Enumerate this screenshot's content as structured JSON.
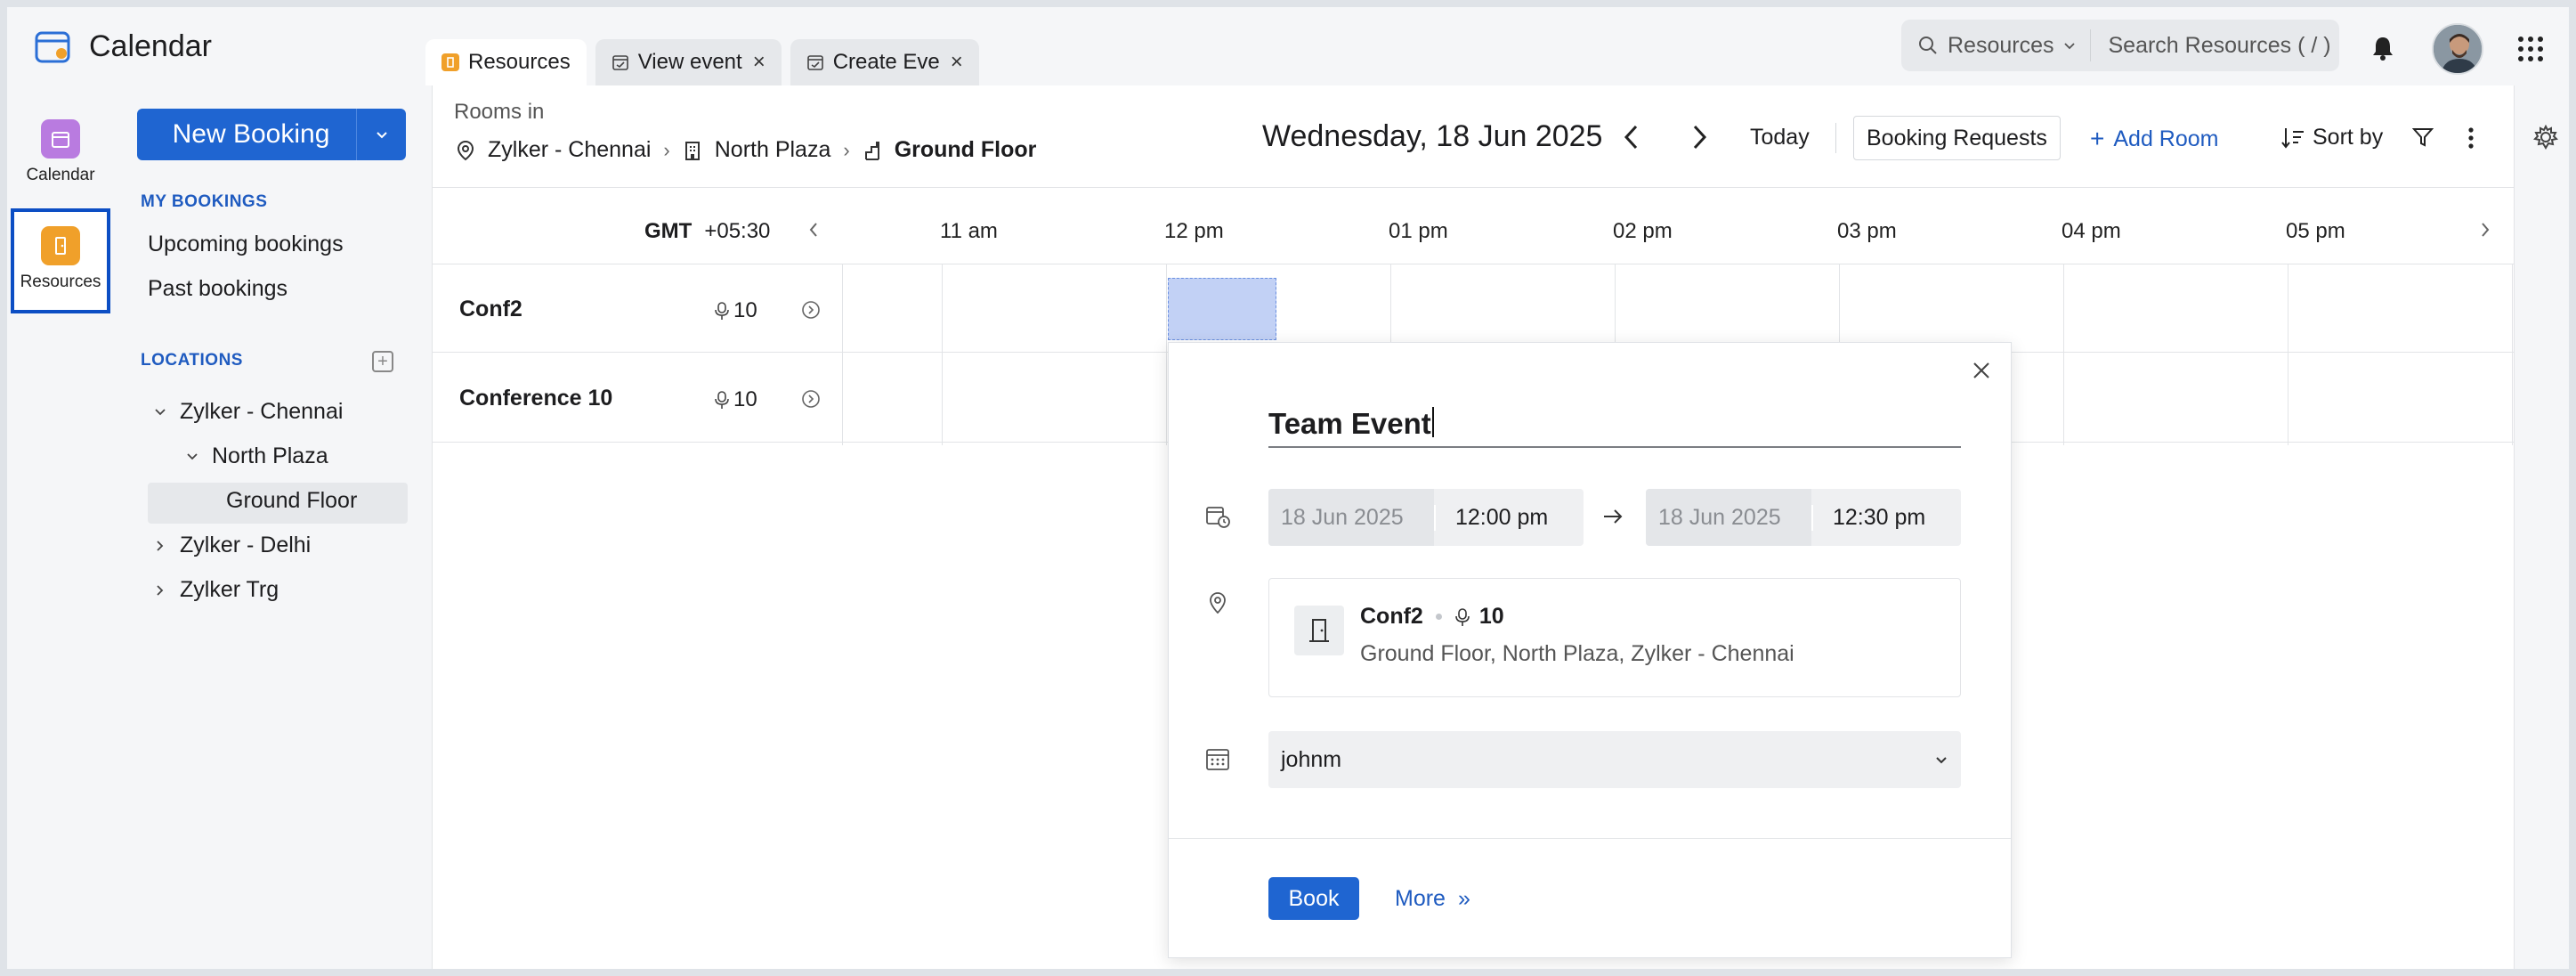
{
  "app": {
    "title": "Calendar"
  },
  "tabs": [
    {
      "label": "Resources"
    },
    {
      "label": "View event"
    },
    {
      "label": "Create Eve"
    }
  ],
  "search": {
    "scope": "Resources",
    "placeholder": "Search Resources ( / )"
  },
  "rail": {
    "calendar_label": "Calendar",
    "resources_label": "Resources"
  },
  "sidebar": {
    "new_booking": "New Booking",
    "my_bookings_heading": "MY BOOKINGS",
    "upcoming": "Upcoming bookings",
    "past": "Past bookings",
    "locations_heading": "LOCATIONS",
    "tree": [
      {
        "label": "Zylker - Chennai",
        "expanded": true
      },
      {
        "label": "North Plaza",
        "expanded": true
      },
      {
        "label": "Ground Floor",
        "selected": true
      },
      {
        "label": "Zylker - Delhi",
        "expanded": false
      },
      {
        "label": "Zylker Trg",
        "expanded": false
      }
    ]
  },
  "header": {
    "rooms_in": "Rooms in",
    "crumbs": [
      "Zylker - Chennai",
      "North Plaza",
      "Ground Floor"
    ],
    "date": "Wednesday, 18 Jun 2025",
    "today": "Today",
    "booking_requests": "Booking Requests",
    "add_room": "Add Room",
    "sort_by": "Sort by"
  },
  "timeline": {
    "gmt_label": "GMT",
    "gmt_offset": "+05:30",
    "hours": [
      "11 am",
      "12 pm",
      "01 pm",
      "02 pm",
      "03 pm",
      "04 pm",
      "05 pm"
    ],
    "rooms": [
      {
        "name": "Conf2",
        "capacity": "10"
      },
      {
        "name": "Conference 10",
        "capacity": "10"
      }
    ]
  },
  "popup": {
    "title": "Team Event",
    "start_date": "18 Jun 2025",
    "start_time": "12:00 pm",
    "end_date": "18 Jun 2025",
    "end_time": "12:30 pm",
    "room_name": "Conf2",
    "room_capacity": "10",
    "room_address": "Ground Floor, North Plaza, Zylker - Chennai",
    "owner": "johnm",
    "book": "Book",
    "more": "More",
    "more_glyph": "»"
  },
  "colors": {
    "accent": "#1f65d1",
    "selection": "#c2d1f5",
    "resources_icon": "#f0a02a",
    "calendar_icon": "#b97be0"
  },
  "icons": [
    "calendar-logo-icon",
    "search-icon",
    "bell-icon",
    "apps-grid-icon",
    "location-pin-icon",
    "building-icon",
    "floor-icon",
    "filter-icon",
    "gear-icon",
    "close-icon",
    "door-icon",
    "mic-icon"
  ]
}
